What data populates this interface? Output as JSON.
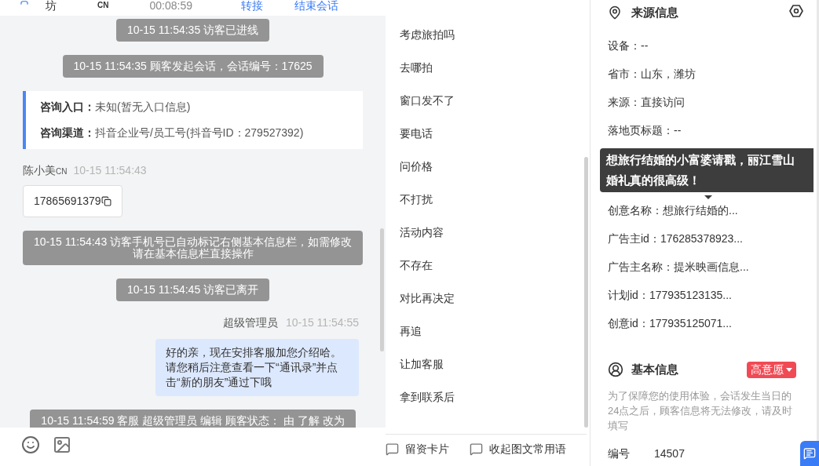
{
  "header": {
    "name_fragment": "坊",
    "tag": "CN",
    "duration": "00:08:59",
    "actions": [
      "转接",
      "结束会话"
    ]
  },
  "messages": [
    {
      "kind": "system",
      "text": "10-15 11:54:35 访客已进线"
    },
    {
      "kind": "system",
      "text": "10-15 11:54:35 顾客发起会话，会话编号：17625"
    },
    {
      "kind": "info",
      "lines": [
        {
          "label": "咨询入口：",
          "value": "未知(暂无入口信息)"
        },
        {
          "label": "咨询渠道：",
          "value": "抖音企业号/员工号(抖音号ID：279527392)"
        }
      ]
    },
    {
      "kind": "visitor",
      "name": "陈小美",
      "tag": "CN",
      "time": "10-15 11:54:43",
      "content": "17865691379"
    },
    {
      "kind": "system",
      "text": "10-15 11:54:43 访客手机号已自动标记右侧基本信息栏，如需修改请在基本信息栏直接操作"
    },
    {
      "kind": "system",
      "text": "10-15 11:54:45 访客已离开"
    },
    {
      "kind": "agent",
      "name": "超级管理员",
      "time": "10-15 11:54:55",
      "content": "好的亲，现在安排客服加您介绍哈。请您稍后注意查看一下“通讯录”并点击“新的朋友”通过下哦"
    },
    {
      "kind": "system",
      "text": "10-15 11:54:59 客服 超级管理员 编辑 顾客状态： 由 了解 改为"
    }
  ],
  "phrases": [
    "考虑旅拍吗",
    "去哪拍",
    "窗口发不了",
    "要电话",
    "问价格",
    "不打扰",
    "活动内容",
    "不存在",
    "对比再决定",
    "再追",
    "让加客服",
    "拿到联系后"
  ],
  "phrase_actions": [
    "留资卡片",
    "收起图文常用语"
  ],
  "source": {
    "title": "来源信息",
    "fields": [
      "设备：--",
      "省市：山东，潍坊",
      "来源：直接访问",
      "落地页标题：--",
      "创意名称：想旅行结婚的...",
      "广告主id：176285378923...",
      "广告主名称：提米映画信息...",
      "计划id：177935123135...",
      "创意id：177935125071..."
    ]
  },
  "tooltip": {
    "text": "想旅行结婚的小富婆请戳，丽江雪山婚礼真的很高级！"
  },
  "basic": {
    "title": "基本信息",
    "intent": "高意愿",
    "note": "为了保障您的使用体验，会话发生当日的24点之后，顾客信息将无法修改，请及时填写",
    "fields": [
      {
        "label": "编号",
        "value": "14507"
      }
    ]
  }
}
